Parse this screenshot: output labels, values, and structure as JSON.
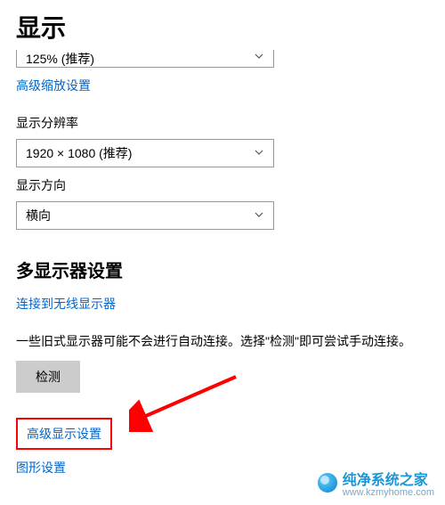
{
  "page_title": "显示",
  "scale": {
    "value": "125% (推荐)"
  },
  "advanced_scale_link": "高级缩放设置",
  "resolution": {
    "label": "显示分辨率",
    "value": "1920 × 1080 (推荐)"
  },
  "orientation": {
    "label": "显示方向",
    "value": "横向"
  },
  "multi_display": {
    "title": "多显示器设置",
    "wireless_link": "连接到无线显示器",
    "desc": "一些旧式显示器可能不会进行自动连接。选择\"检测\"即可尝试手动连接。",
    "detect_btn": "检测",
    "advanced_link": "高级显示设置",
    "graphics_link": "图形设置"
  },
  "watermark": {
    "name": "纯净系统之家",
    "url": "www.kzmyhome.com"
  }
}
